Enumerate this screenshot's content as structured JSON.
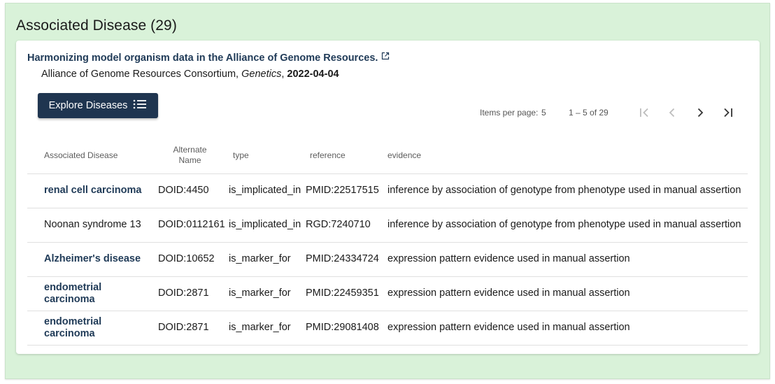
{
  "panel": {
    "title": "Associated Disease (29)"
  },
  "reference": {
    "title": "Harmonizing model organism data in the Alliance of Genome Resources.",
    "authors": "Alliance of Genome Resources Consortium, ",
    "journal": "Genetics",
    "separator": ", ",
    "date": "2022-04-04"
  },
  "toolbar": {
    "explore_label": "Explore Diseases"
  },
  "pagination": {
    "items_per_page_label": "Items per page:",
    "items_per_page_value": "5",
    "range_label": "1 – 5 of 29"
  },
  "table": {
    "columns": {
      "disease": "Associated Disease",
      "alternate_name": "Alternate Name",
      "type": "type",
      "reference": "reference",
      "evidence": "evidence"
    },
    "rows": [
      {
        "disease": "renal cell carcinoma",
        "alternate_name": "DOID:4450",
        "type": "is_implicated_in",
        "reference": "PMID:22517515",
        "evidence": "inference by association of genotype from phenotype used in manual assertion"
      },
      {
        "disease": "Noonan syndrome 13",
        "alternate_name": "DOID:0112161",
        "type": "is_implicated_in",
        "reference": "RGD:7240710",
        "evidence": "inference by association of genotype from phenotype used in manual assertion"
      },
      {
        "disease": "Alzheimer's disease",
        "alternate_name": "DOID:10652",
        "type": "is_marker_for",
        "reference": "PMID:24334724",
        "evidence": "expression pattern evidence used in manual assertion"
      },
      {
        "disease": "endometrial carcinoma",
        "alternate_name": "DOID:2871",
        "type": "is_marker_for",
        "reference": "PMID:22459351",
        "evidence": "expression pattern evidence used in manual assertion"
      },
      {
        "disease": "endometrial carcinoma",
        "alternate_name": "DOID:2871",
        "type": "is_marker_for",
        "reference": "PMID:29081408",
        "evidence": "expression pattern evidence used in manual assertion"
      }
    ]
  },
  "colors": {
    "panel_bg": "#d9f2d9",
    "button_bg": "#1f3550",
    "link_text": "#1f3a57"
  },
  "icons": {
    "external_link": "external-link-icon",
    "list": "list-icon",
    "first_page": "first-page-icon",
    "prev_page": "chevron-left-icon",
    "next_page": "chevron-right-icon",
    "last_page": "last-page-icon"
  }
}
